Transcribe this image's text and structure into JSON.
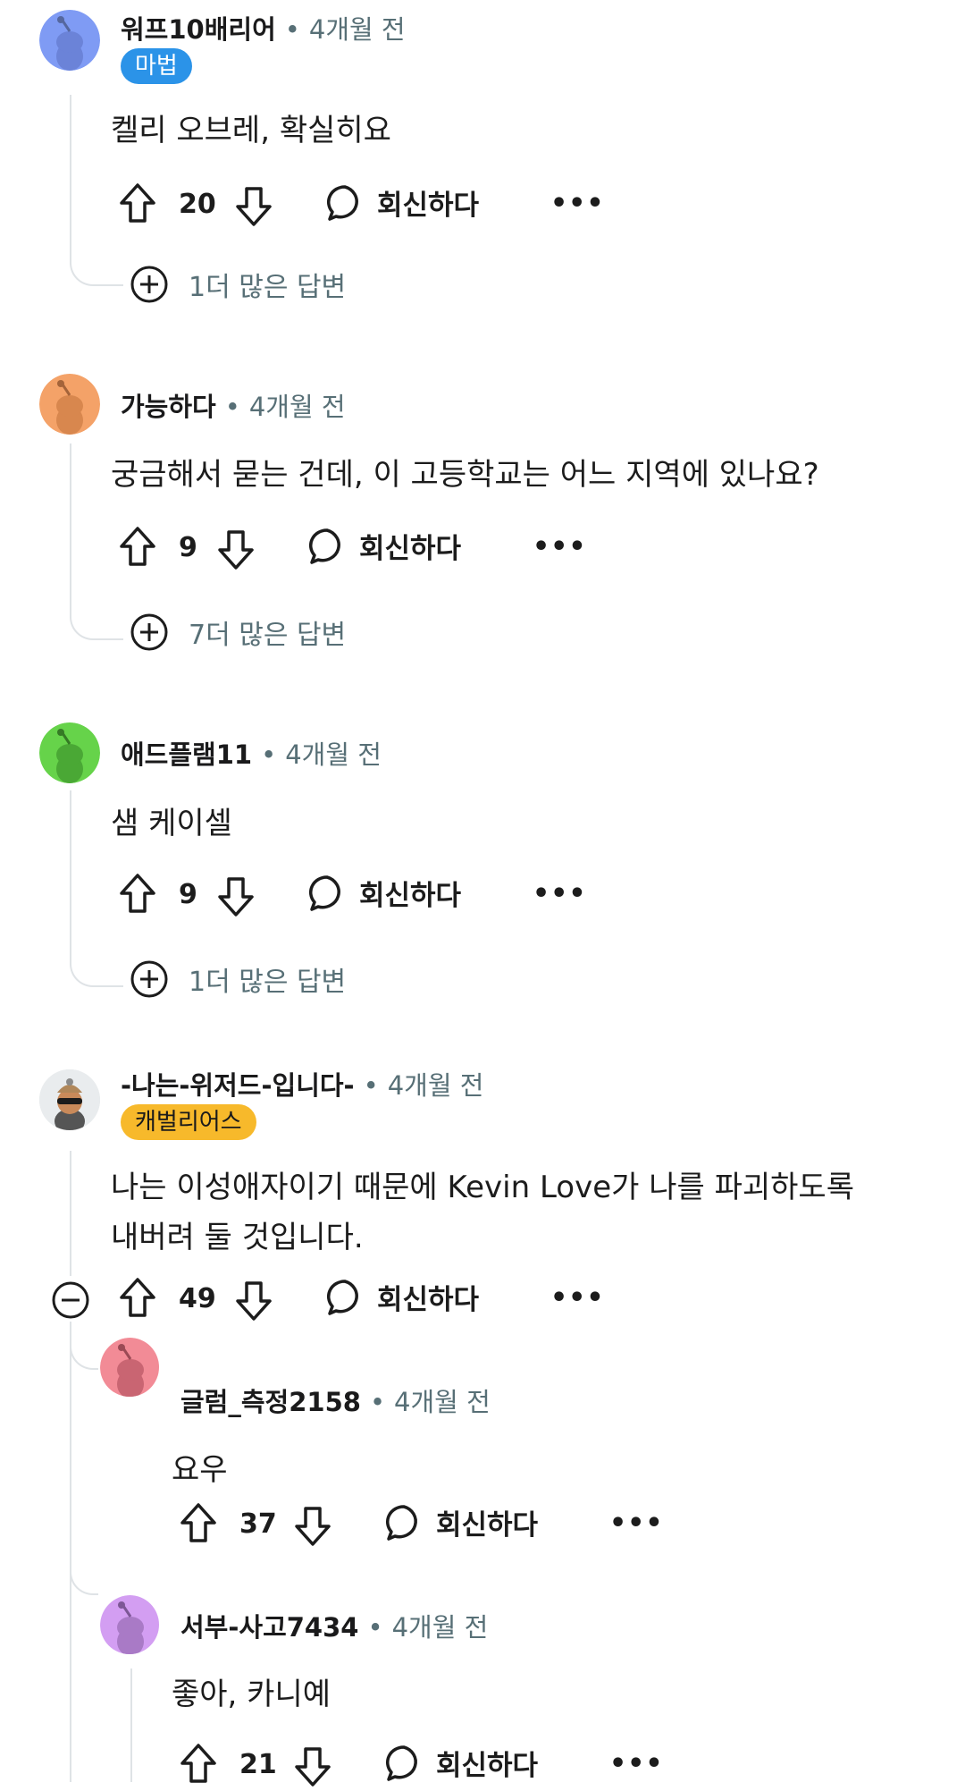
{
  "comments": [
    {
      "username": "워프10배리어",
      "time": "4개월 전",
      "flair": "마법",
      "body": "켈리 오브레, 확실히요",
      "votes": "20",
      "reply_label": "회신하다",
      "more_replies": "1더 많은 답변",
      "avatar_color": "#7f9bf4"
    },
    {
      "username": "가능하다",
      "time": "4개월 전",
      "body": "궁금해서 묻는 건데, 이 고등학교는 어느 지역에 있나요?",
      "votes": "9",
      "reply_label": "회신하다",
      "more_replies": "7더 많은 답변",
      "avatar_color": "#f4a268"
    },
    {
      "username": "애드플램11",
      "time": "4개월 전",
      "body": "샘 케이셀",
      "votes": "9",
      "reply_label": "회신하다",
      "more_replies": "1더 많은 답변",
      "avatar_color": "#66d34a"
    },
    {
      "username": "-나는-위저드-입니다-",
      "time": "4개월 전",
      "flair": "캐벌리어스",
      "body_line1": "나는 이성애자이기 때문에 Kevin Love가 나를 파괴하도록",
      "body_line2": "내버려 둘 것입니다.",
      "votes": "49",
      "reply_label": "회신하다",
      "replies": [
        {
          "username": "글럼_측정2158",
          "time": "4개월 전",
          "body": "요우",
          "votes": "37",
          "reply_label": "회신하다",
          "avatar_color": "#f28b96"
        },
        {
          "username": "서부-사고7434",
          "time": "4개월 전",
          "body": "좋아, 카니예",
          "votes": "21",
          "reply_label": "회신하다",
          "avatar_color": "#d39ef2"
        }
      ]
    }
  ],
  "separator": "•",
  "more_glyph": "•••"
}
